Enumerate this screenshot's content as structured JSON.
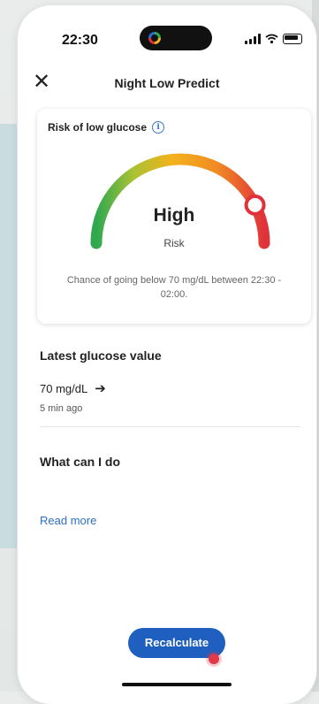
{
  "status": {
    "time": "22:30"
  },
  "header": {
    "title": "Night Low Predict",
    "close_icon": "close-icon"
  },
  "risk_card": {
    "label": "Risk of low glucose",
    "info_icon": "info-icon",
    "level": "High",
    "sub": "Risk",
    "gauge_value": 0.85,
    "chance_text": "Chance of going below 70 mg/dL between 22:30 - 02:00."
  },
  "glucose": {
    "title": "Latest glucose value",
    "value": "70 mg/dL",
    "trend_icon": "arrow-right-icon",
    "time": "5 min ago"
  },
  "advice": {
    "title": "What can I do",
    "read_more": "Read more"
  },
  "actions": {
    "recalculate": "Recalculate"
  },
  "colors": {
    "accent": "#1f5fbf",
    "link": "#2e6fc0",
    "gauge_green": "#2fa84f",
    "gauge_yellow": "#f3b21b",
    "gauge_red": "#e0323a"
  }
}
